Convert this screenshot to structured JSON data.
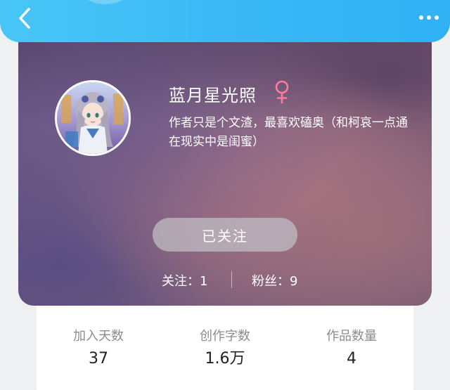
{
  "colors": {
    "header_gradient_start": "#49c6f7",
    "header_gradient_end": "#2fb1f4",
    "female_symbol": "#ff7a9c",
    "stat_label": "#8c8c8c",
    "stat_value": "#222222"
  },
  "header": {
    "back_icon": "chevron-left-icon",
    "more_icon": "more-dots-icon"
  },
  "profile": {
    "name": "蓝月星光照",
    "gender_symbol": "female-symbol-icon",
    "bio": "作者只是个文渣，最喜欢磕奥（和柯哀一点通在现实中是闺蜜）",
    "follow_button_label": "已关注",
    "following_text": "关注：1",
    "fans_text": "粉丝：9"
  },
  "stats": [
    {
      "label": "加入天数",
      "value": "37"
    },
    {
      "label": "创作字数",
      "value": "1.6万"
    },
    {
      "label": "作品数量",
      "value": "4"
    }
  ]
}
